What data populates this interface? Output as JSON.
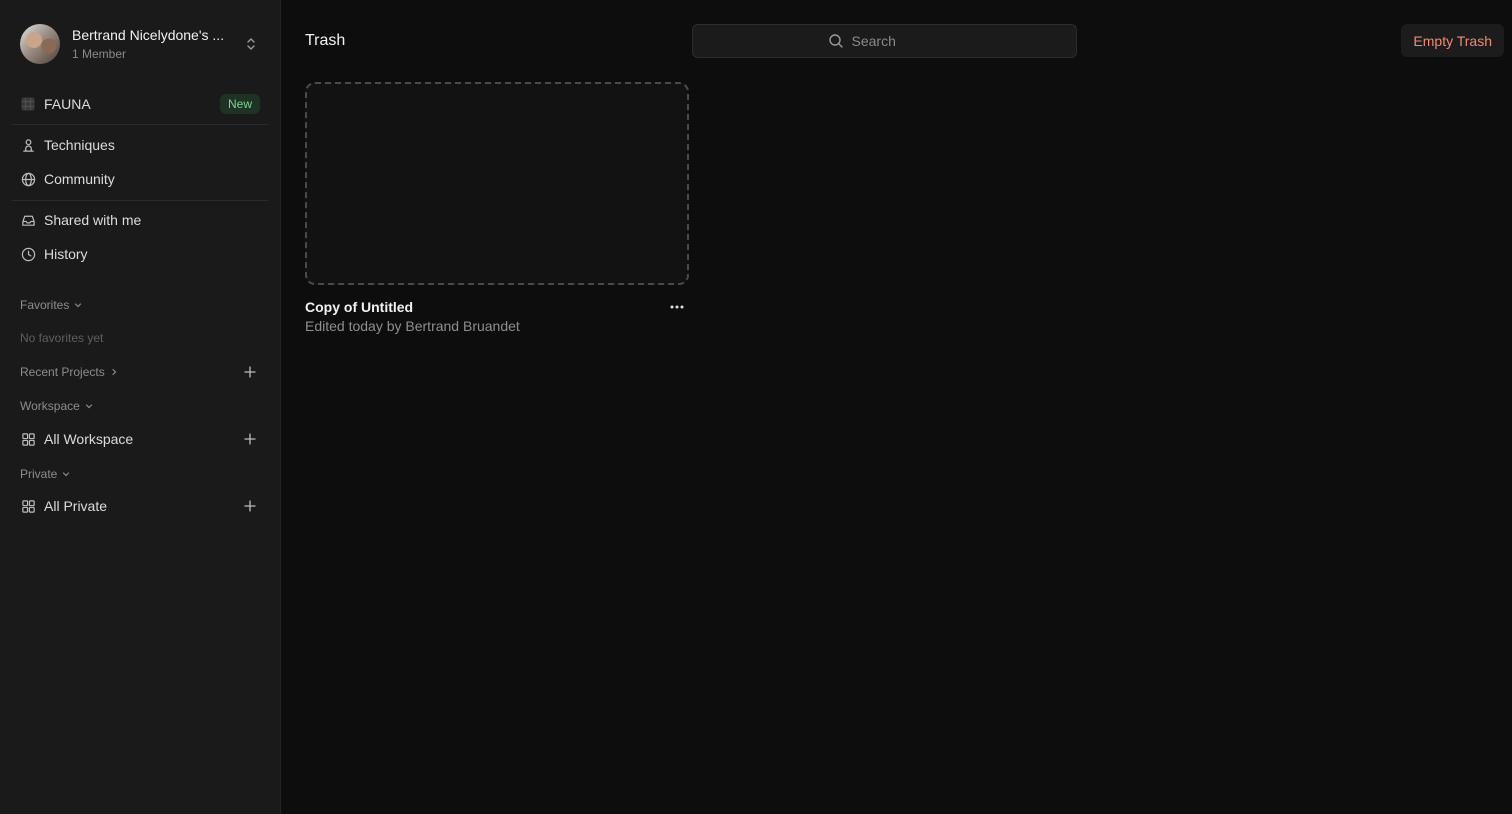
{
  "workspace": {
    "name": "Bertrand Nicelydone's ...",
    "members": "1 Member"
  },
  "sidebar": {
    "fauna": {
      "label": "FAUNA",
      "badge": "New"
    },
    "items": [
      {
        "label": "Techniques",
        "icon": "person-stand-icon"
      },
      {
        "label": "Community",
        "icon": "globe-icon"
      },
      {
        "label": "Shared with me",
        "icon": "inbox-icon"
      },
      {
        "label": "History",
        "icon": "clock-icon"
      }
    ],
    "favorites": {
      "label": "Favorites",
      "empty": "No favorites yet"
    },
    "recent": {
      "label": "Recent Projects"
    },
    "workspace_section": {
      "label": "Workspace",
      "item": "All Workspace"
    },
    "private_section": {
      "label": "Private",
      "item": "All Private"
    }
  },
  "main": {
    "title": "Trash",
    "search_placeholder": "Search",
    "empty_trash": "Empty Trash",
    "card": {
      "title": "Copy of Untitled",
      "subtitle": "Edited today by Bertrand Bruandet"
    }
  },
  "colors": {
    "accent_danger": "#f08a73",
    "badge_green": "#7fd494",
    "background": "#0d0d0d",
    "sidebar": "#1a1a1a"
  }
}
